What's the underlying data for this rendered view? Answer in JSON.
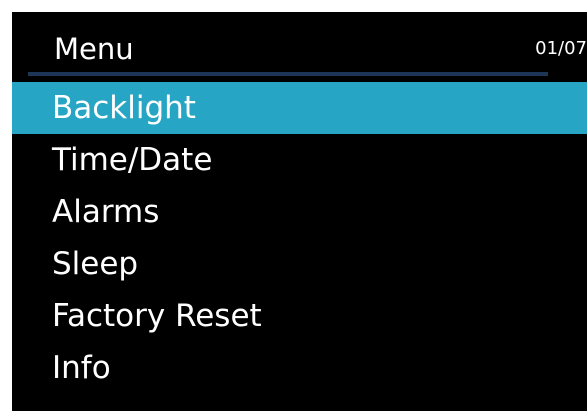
{
  "header": {
    "title": "Menu",
    "page_indicator": "01/07"
  },
  "menu": {
    "selected_index": 0,
    "items": [
      {
        "label": "Backlight"
      },
      {
        "label": "Time/Date"
      },
      {
        "label": "Alarms"
      },
      {
        "label": "Sleep"
      },
      {
        "label": "Factory Reset"
      },
      {
        "label": "Info"
      }
    ]
  },
  "colors": {
    "background": "#000000",
    "text": "#ffffff",
    "highlight": "#26a6c4",
    "divider": "#1d3557"
  }
}
